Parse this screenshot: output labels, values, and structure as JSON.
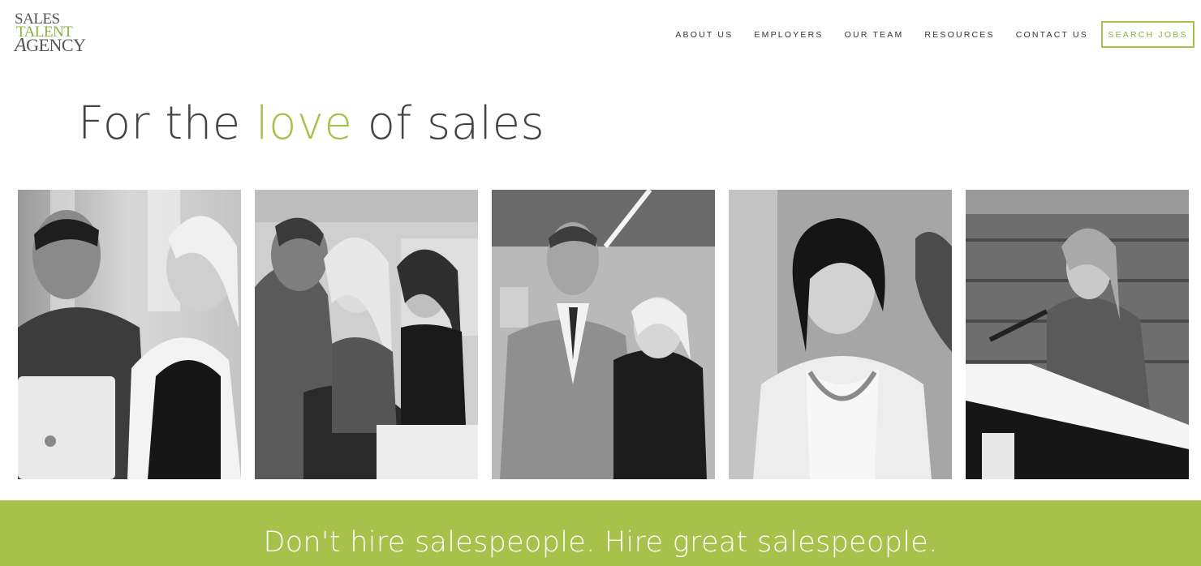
{
  "logo": {
    "line1": "SALES",
    "line2": "TALENT",
    "line3_initial": "A",
    "line3_rest": "GENCY"
  },
  "nav": {
    "items": [
      {
        "label": "ABOUT US"
      },
      {
        "label": "EMPLOYERS"
      },
      {
        "label": "OUR TEAM"
      },
      {
        "label": "RESOURCES"
      },
      {
        "label": "CONTACT US"
      }
    ],
    "search_jobs": "SEARCH JOBS"
  },
  "hero": {
    "prefix": "For the",
    "accent_word": "love",
    "suffix": "of sales"
  },
  "photos": [
    {
      "name": "photo-man-and-woman-laptop"
    },
    {
      "name": "photo-meeting-group"
    },
    {
      "name": "photo-man-in-suit-and-woman"
    },
    {
      "name": "photo-smiling-woman"
    },
    {
      "name": "photo-woman-at-podium"
    }
  ],
  "banner": {
    "text": "Don't hire salespeople. Hire great salespeople."
  },
  "colors": {
    "accent": "#a6c24a",
    "text": "#444444",
    "background": "#ffffff"
  }
}
